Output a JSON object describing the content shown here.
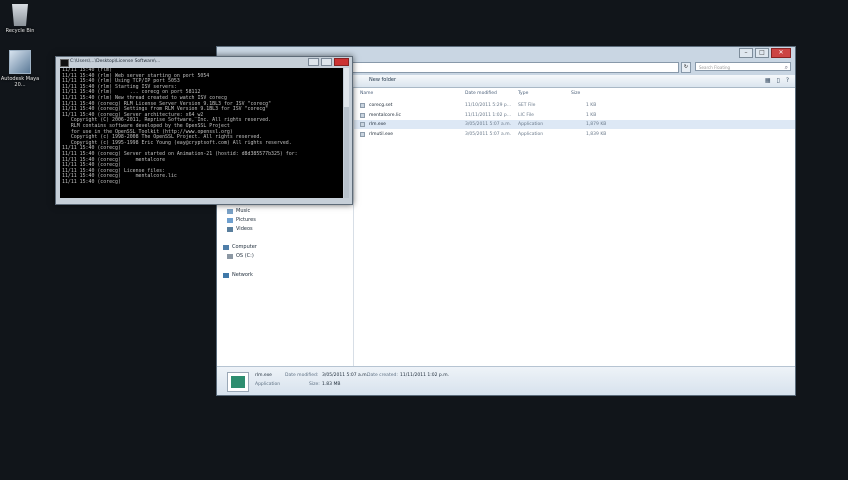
{
  "desktop": {
    "icons": [
      {
        "label": "Recycle Bin",
        "icon": "recycle-bin-icon"
      },
      {
        "label": "Autodesk Maya 20...",
        "icon": "maya-shortcut-icon"
      }
    ]
  },
  "console": {
    "title": "C:\\Users\\...\\Desktop\\License Software\\...",
    "lines": [
      "11/11 15:40 (rlm) ",
      "11/11 15:40 (rlm) Web server starting on port 5054",
      "11/11 15:40 (rlm) Using TCP/IP port 5053",
      "11/11 15:40 (rlm) Starting ISV servers:",
      "11/11 15:40 (rlm)      ... corecg on port 58112",
      "11/11 15:40 (rlm) New thread created to watch ISV corecg",
      "11/11 15:40 (corecg) RLM License Server Version 9.1BL3 for ISV \"corecg\"",
      "11/11 15:40 (corecg) Settings from RLM Version 9.1BL3 for ISV \"corecg\"",
      "11/11 15:40 (corecg) Server architecture: x64_w2",
      "",
      "   Copyright (C) 2006-2011, Reprise Software, Inc. All rights reserved.",
      "",
      "   RLM contains software developed by the OpenSSL Project",
      "   for use in the OpenSSL Toolkit (http://www.openssl.org)",
      "   Copyright (c) 1998-2008 The OpenSSL Project. All rights reserved.",
      "   Copyright (c) 1995-1998 Eric Young (eay@cryptsoft.com) All rights reserved.",
      "",
      "11/11 15:40 (corecg) ",
      "11/11 15:40 (corecg) Server started on Animation-21 (hostid: d8d385577b325) for:",
      "11/11 15:40 (corecg)     mentalcore",
      "11/11 15:40 (corecg) ",
      "11/11 15:40 (corecg) License files:",
      "11/11 15:40 (corecg)     mentalcore.lic",
      "11/11 15:40 (corecg) "
    ]
  },
  "explorer": {
    "search_placeholder": "Search Floating",
    "toolbar": {
      "new_folder": "New folder"
    },
    "columns": [
      "Name",
      "Date modified",
      "Type",
      "Size"
    ],
    "files": [
      {
        "name": "corecg.set",
        "date": "11/10/2011 5:29 p...",
        "type": "SET File",
        "size": "1 KB",
        "selected": false
      },
      {
        "name": "mentalcore.lic",
        "date": "11/11/2011 1:02 p...",
        "type": "LIC File",
        "size": "1 KB",
        "selected": false
      },
      {
        "name": "rlm.exe",
        "date": "3/05/2011 5:07 a.m.",
        "type": "Application",
        "size": "1,879 KB",
        "selected": true
      },
      {
        "name": "rlmutil.exe",
        "date": "3/05/2011 5:07 a.m.",
        "type": "Application",
        "size": "1,839 KB",
        "selected": false
      }
    ],
    "nav": [
      {
        "label": "Music",
        "icon": "music-icon"
      },
      {
        "label": "Pictures",
        "icon": "pictures-icon"
      },
      {
        "label": "Videos",
        "icon": "videos-icon"
      },
      {
        "label": "Computer",
        "icon": "computer-icon"
      },
      {
        "label": "OS (C:)",
        "icon": "drive-icon"
      },
      {
        "label": "Network",
        "icon": "network-icon"
      }
    ],
    "details": {
      "name": "rlm.exe",
      "type": "Application",
      "modified_label": "Date modified:",
      "modified_value": "3/05/2011 5:07 a.m.",
      "created_label": "Date created:",
      "created_value": "11/11/2011 1:02 p.m.",
      "size_label": "Size:",
      "size_value": "1.83 MB"
    }
  }
}
